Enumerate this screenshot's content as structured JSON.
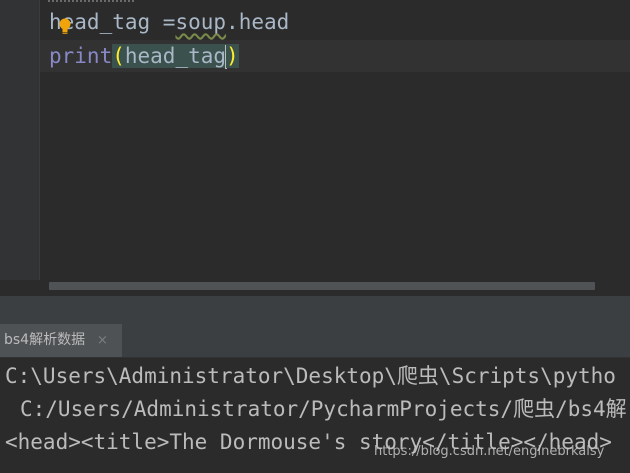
{
  "editor": {
    "lines": [
      {
        "var": "head_tag",
        "op": " =",
        "obj": "soup",
        "dot": ".",
        "attr": "head"
      },
      {
        "func": "print",
        "open_paren": "(",
        "arg": "head_tag",
        "close_paren": ")"
      }
    ]
  },
  "run_panel": {
    "tab_label": "bs4解析数据",
    "close_glyph": "×"
  },
  "console": {
    "lines": [
      "C:\\Users\\Administrator\\Desktop\\爬虫\\Scripts\\pytho",
      "C:/Users/Administrator/PycharmProjects/爬虫/bs4解",
      "<head><title>The Dormouse's story</title></head>"
    ]
  },
  "watermark": "https://blog.csdn.net/enginebrkalsy",
  "colors": {
    "editor_bg": "#2b2b2b",
    "gutter_bg": "#313335",
    "keyword_builtin": "#8888c6",
    "paren_match": "#ffef28",
    "paren_match_bg": "#3b514d",
    "text": "#a9b7c6",
    "console_text": "#bbbbbb",
    "tool_bar_bg": "#3c3f41"
  }
}
